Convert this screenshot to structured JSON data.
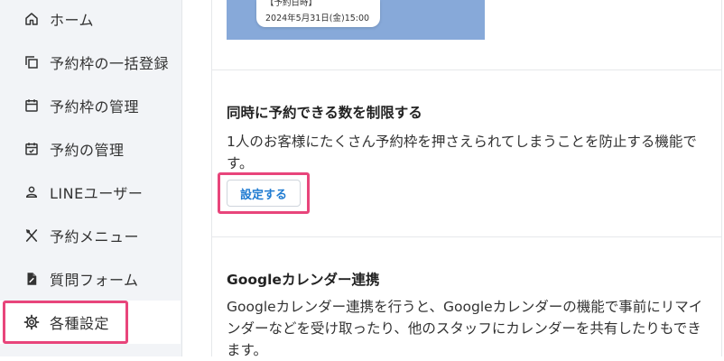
{
  "sidebar": {
    "items": [
      {
        "label": "ホーム",
        "icon": "home-icon"
      },
      {
        "label": "予約枠の一括登録",
        "icon": "copy-icon"
      },
      {
        "label": "予約枠の管理",
        "icon": "calendar-icon"
      },
      {
        "label": "予約の管理",
        "icon": "calendar-check-icon"
      },
      {
        "label": "LINEユーザー",
        "icon": "user-icon"
      },
      {
        "label": "予約メニュー",
        "icon": "utensils-icon"
      },
      {
        "label": "質問フォーム",
        "icon": "form-icon"
      },
      {
        "label": "各種設定",
        "icon": "gear-icon"
      }
    ],
    "active_index": 7
  },
  "preview": {
    "card_line1": "【予約日時】",
    "card_line2": "2024年5月31日(金)15:00"
  },
  "limit_section": {
    "title": "同時に予約できる数を制限する",
    "description": "1人のお客様にたくさん予約枠を押さえられてしまうことを防止する機能です。",
    "button_label": "設定する"
  },
  "google_section": {
    "title": "Googleカレンダー連携",
    "description": "Googleカレンダー連携を行うと、Googleカレンダーの機能で事前にリマインダーなどを受け取ったり、他のスタッフにカレンダーを共有したりもできます。"
  },
  "colors": {
    "highlight": "#e8457b",
    "button_text": "#1f7bd1",
    "preview_bg": "#87a9d9",
    "sidebar_bg": "#f2f4f7"
  }
}
